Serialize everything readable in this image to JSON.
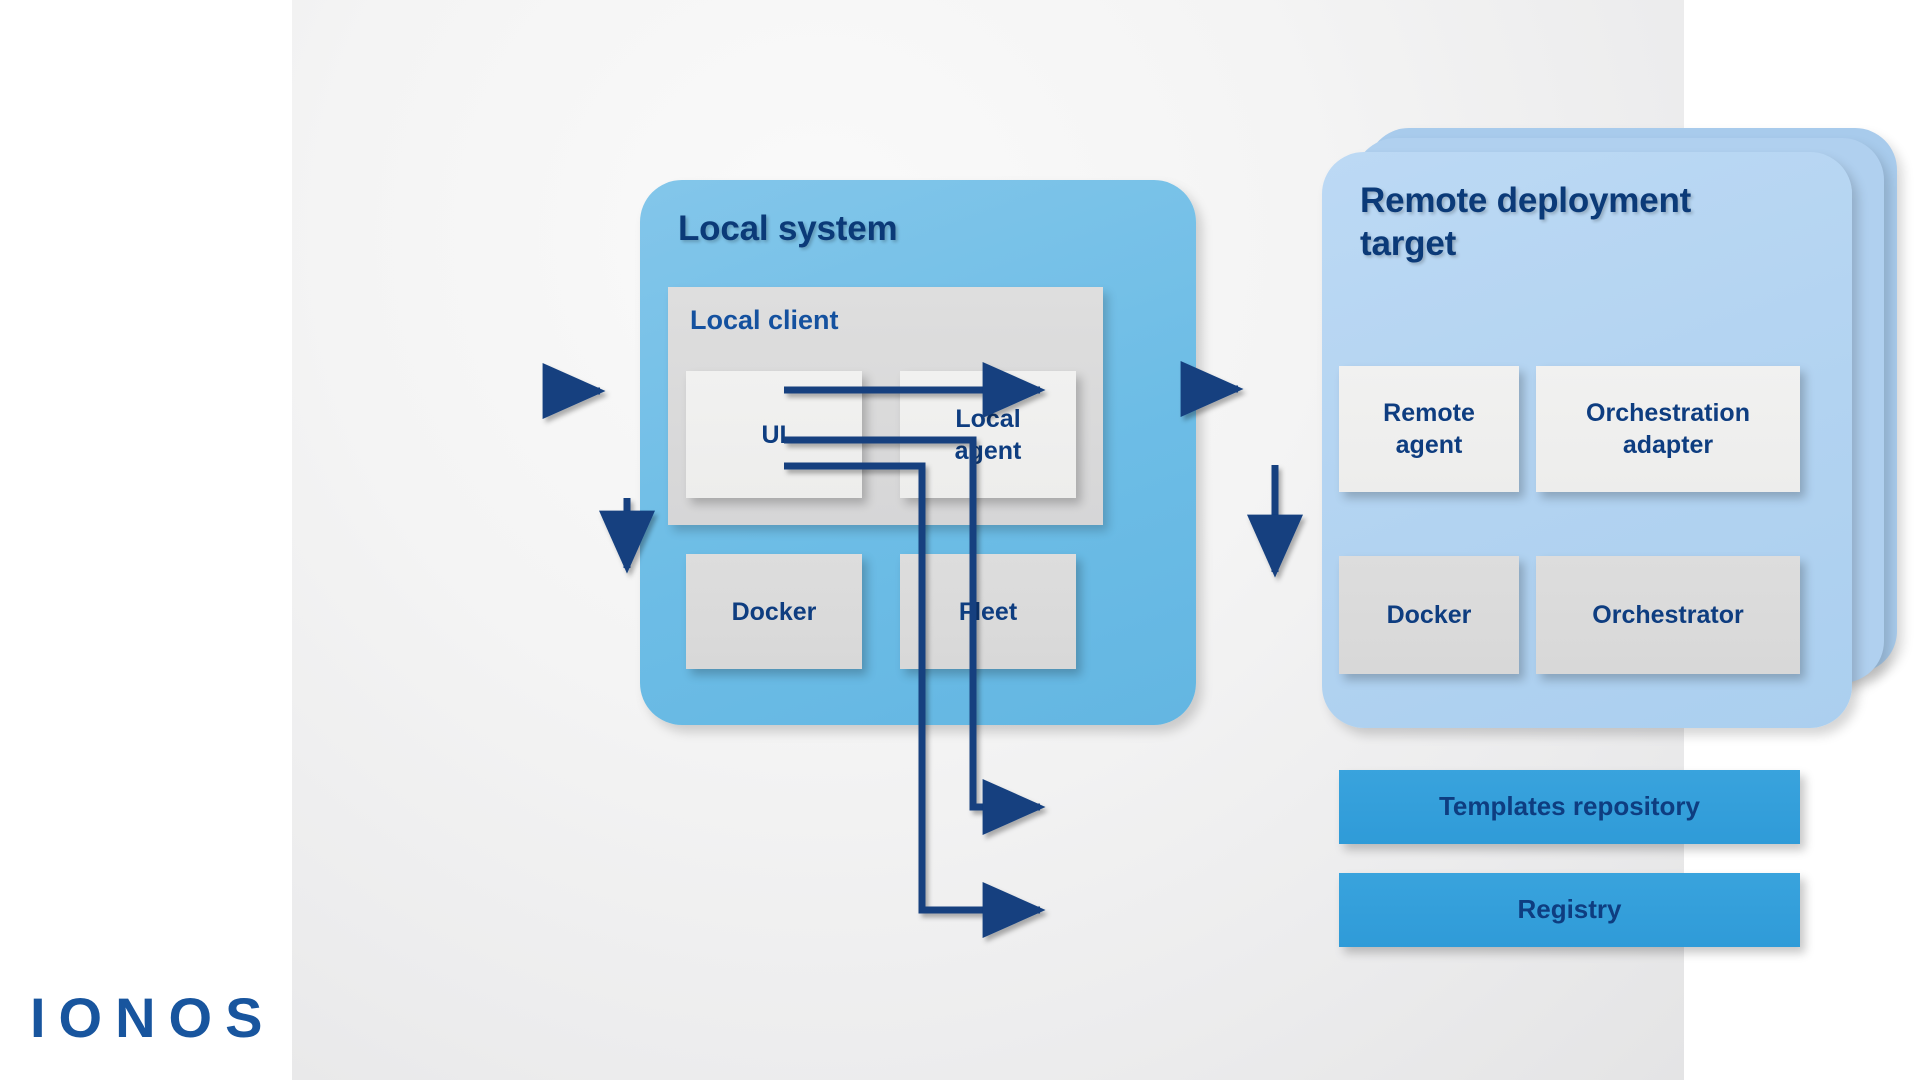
{
  "diagram": {
    "title_local": "Local system",
    "title_remote": "Remote deployment target",
    "local_client_label": "Local client",
    "nodes": {
      "ui": "UI",
      "local_agent": "Local\nagent",
      "docker_local": "Docker",
      "fleet": "Fleet",
      "remote_agent": "Remote\nagent",
      "orchestration_adapter": "Orchestration\nadapter",
      "docker_remote": "Docker",
      "orchestrator": "Orchestrator",
      "templates_repository": "Templates repository",
      "registry": "Registry"
    },
    "colors": {
      "local_panel": "#6dbde6",
      "remote_panel": "#b2d3f1",
      "node_light": "#f0f0ef",
      "node_grey": "#dadada",
      "node_blue": "#33a0db",
      "arrow": "#123f7f",
      "text_dark_blue": "#0e3d80",
      "title_blue": "#0b3a78",
      "logo_blue": "#18559e",
      "canvas": "#f1f1f1"
    }
  },
  "brand": {
    "logo_text": "IONOS"
  }
}
